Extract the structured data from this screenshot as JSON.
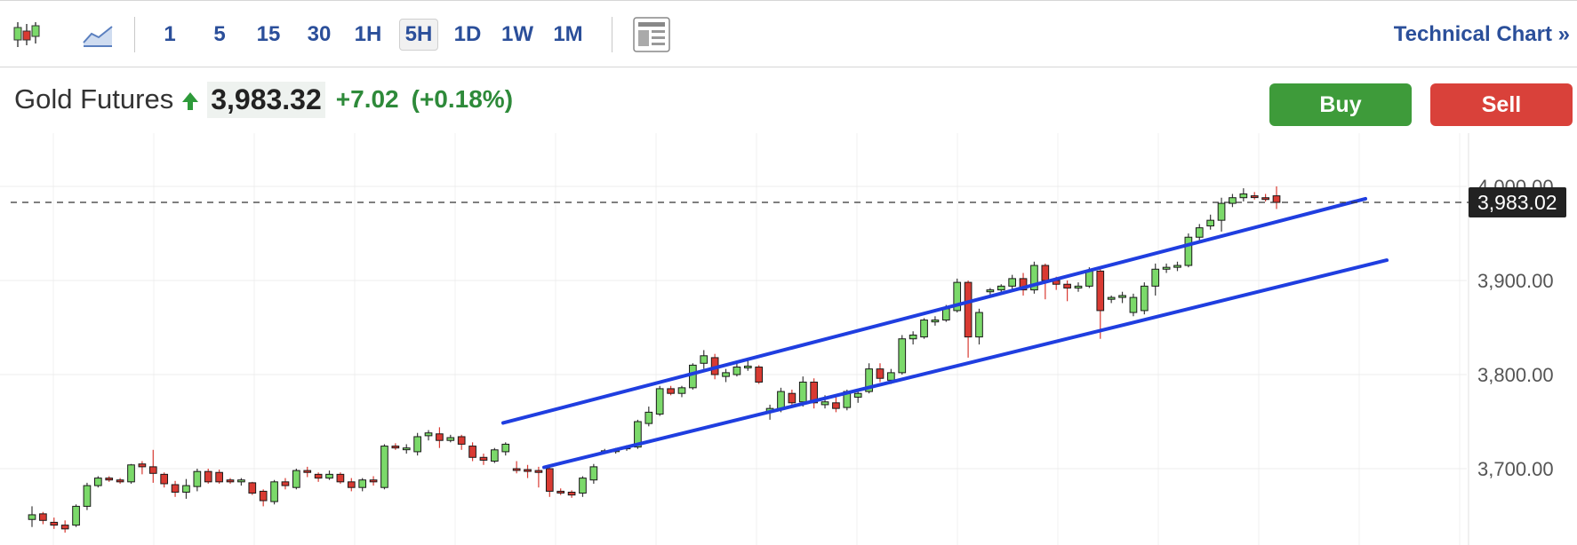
{
  "toolbar": {
    "chart_type_icons": [
      "candlestick-icon",
      "area-chart-icon"
    ],
    "intervals": [
      "1",
      "5",
      "15",
      "30",
      "1H",
      "5H",
      "1D",
      "1W",
      "1M"
    ],
    "active_interval": "5H",
    "layout_icon": "layout-icon",
    "technical_link": "Technical Chart »"
  },
  "quote": {
    "name": "Gold Futures",
    "direction_icon": "arrow-up-icon",
    "price": "3,983.32",
    "change": "+7.02",
    "change_pct": "(+0.18%)",
    "up_color": "#2e9a3a"
  },
  "actions": {
    "buy": "Buy",
    "sell": "Sell",
    "buy_color": "#3e9b3a",
    "sell_color": "#d9413a"
  },
  "chart_data": {
    "type": "candlestick",
    "y_ticks": [
      "4,000.00",
      "3,900.00",
      "3,800.00",
      "3,700.00"
    ],
    "y_tick_values": [
      4000,
      3900,
      3800,
      3700
    ],
    "ylim": [
      3640,
      4050
    ],
    "last_price_label": "3,983.02",
    "last_price": 3983.02,
    "candles": [
      [
        3646,
        3660,
        3638,
        3651
      ],
      [
        3652,
        3654,
        3641,
        3645
      ],
      [
        3643,
        3648,
        3636,
        3640
      ],
      [
        3640,
        3645,
        3632,
        3636
      ],
      [
        3640,
        3662,
        3638,
        3660
      ],
      [
        3660,
        3685,
        3656,
        3682
      ],
      [
        3682,
        3692,
        3680,
        3690
      ],
      [
        3690,
        3692,
        3686,
        3688
      ],
      [
        3688,
        3690,
        3684,
        3686
      ],
      [
        3686,
        3705,
        3684,
        3704
      ],
      [
        3705,
        3708,
        3694,
        3702
      ],
      [
        3702,
        3720,
        3685,
        3695
      ],
      [
        3694,
        3696,
        3680,
        3684
      ],
      [
        3683,
        3687,
        3670,
        3675
      ],
      [
        3675,
        3689,
        3668,
        3682
      ],
      [
        3681,
        3700,
        3676,
        3697
      ],
      [
        3697,
        3700,
        3684,
        3686
      ],
      [
        3696,
        3699,
        3684,
        3686
      ],
      [
        3688,
        3690,
        3684,
        3686
      ],
      [
        3686,
        3690,
        3682,
        3688
      ],
      [
        3685,
        3686,
        3672,
        3674
      ],
      [
        3676,
        3678,
        3660,
        3666
      ],
      [
        3665,
        3688,
        3662,
        3686
      ],
      [
        3686,
        3690,
        3678,
        3682
      ],
      [
        3680,
        3700,
        3678,
        3698
      ],
      [
        3698,
        3702,
        3691,
        3696
      ],
      [
        3694,
        3696,
        3686,
        3690
      ],
      [
        3690,
        3698,
        3688,
        3694
      ],
      [
        3694,
        3696,
        3684,
        3686
      ],
      [
        3686,
        3690,
        3676,
        3680
      ],
      [
        3680,
        3690,
        3676,
        3688
      ],
      [
        3688,
        3692,
        3682,
        3686
      ],
      [
        3680,
        3726,
        3678,
        3724
      ],
      [
        3724,
        3727,
        3720,
        3722
      ],
      [
        3722,
        3726,
        3716,
        3722
      ],
      [
        3718,
        3738,
        3714,
        3734
      ],
      [
        3735,
        3741,
        3730,
        3738
      ],
      [
        3737,
        3744,
        3722,
        3730
      ],
      [
        3730,
        3736,
        3728,
        3733
      ],
      [
        3734,
        3736,
        3720,
        3726
      ],
      [
        3724,
        3728,
        3708,
        3712
      ],
      [
        3712,
        3716,
        3704,
        3709
      ],
      [
        3708,
        3722,
        3706,
        3720
      ],
      [
        3718,
        3728,
        3714,
        3726
      ],
      [
        3700,
        3708,
        3695,
        3699
      ],
      [
        3699,
        3704,
        3690,
        3698
      ],
      [
        3698,
        3702,
        3680,
        3696
      ],
      [
        3700,
        3703,
        3670,
        3676
      ],
      [
        3676,
        3679,
        3672,
        3675
      ],
      [
        3675,
        3677,
        3669,
        3672
      ],
      [
        3674,
        3692,
        3670,
        3690
      ],
      [
        3688,
        3705,
        3684,
        3702
      ],
      [
        3718,
        3721,
        3716,
        3719
      ],
      [
        3719,
        3722,
        3716,
        3720
      ],
      [
        3722,
        3725,
        3719,
        3723
      ],
      [
        3723,
        3752,
        3721,
        3750
      ],
      [
        3748,
        3766,
        3745,
        3760
      ],
      [
        3758,
        3788,
        3756,
        3785
      ],
      [
        3785,
        3788,
        3778,
        3780
      ],
      [
        3780,
        3788,
        3776,
        3786
      ],
      [
        3786,
        3812,
        3784,
        3810
      ],
      [
        3812,
        3826,
        3806,
        3820
      ],
      [
        3818,
        3822,
        3795,
        3800
      ],
      [
        3798,
        3806,
        3792,
        3802
      ],
      [
        3800,
        3812,
        3798,
        3808
      ],
      [
        3808,
        3818,
        3804,
        3809
      ],
      [
        3808,
        3810,
        3790,
        3792
      ],
      [
        3760,
        3768,
        3752,
        3764
      ],
      [
        3764,
        3786,
        3760,
        3782
      ],
      [
        3780,
        3784,
        3766,
        3770
      ],
      [
        3771,
        3798,
        3766,
        3792
      ],
      [
        3792,
        3796,
        3764,
        3770
      ],
      [
        3768,
        3778,
        3764,
        3771
      ],
      [
        3770,
        3778,
        3760,
        3764
      ],
      [
        3765,
        3784,
        3762,
        3782
      ],
      [
        3776,
        3782,
        3770,
        3780
      ],
      [
        3782,
        3812,
        3780,
        3806
      ],
      [
        3806,
        3812,
        3792,
        3796
      ],
      [
        3794,
        3806,
        3790,
        3802
      ],
      [
        3802,
        3842,
        3800,
        3838
      ],
      [
        3838,
        3846,
        3832,
        3842
      ],
      [
        3840,
        3860,
        3838,
        3858
      ],
      [
        3856,
        3862,
        3852,
        3858
      ],
      [
        3858,
        3874,
        3856,
        3870
      ],
      [
        3868,
        3902,
        3866,
        3898
      ],
      [
        3898,
        3900,
        3818,
        3840
      ],
      [
        3840,
        3870,
        3832,
        3866
      ],
      [
        3888,
        3892,
        3882,
        3890
      ],
      [
        3890,
        3896,
        3886,
        3894
      ],
      [
        3894,
        3906,
        3890,
        3902
      ],
      [
        3902,
        3908,
        3884,
        3890
      ],
      [
        3890,
        3920,
        3886,
        3916
      ],
      [
        3916,
        3918,
        3880,
        3900
      ],
      [
        3900,
        3904,
        3890,
        3896
      ],
      [
        3896,
        3900,
        3878,
        3892
      ],
      [
        3892,
        3898,
        3888,
        3894
      ],
      [
        3894,
        3914,
        3892,
        3910
      ],
      [
        3910,
        3912,
        3838,
        3868
      ],
      [
        3880,
        3884,
        3876,
        3882
      ],
      [
        3882,
        3888,
        3876,
        3884
      ],
      [
        3866,
        3886,
        3862,
        3882
      ],
      [
        3868,
        3898,
        3864,
        3894
      ],
      [
        3894,
        3918,
        3884,
        3912
      ],
      [
        3912,
        3918,
        3908,
        3914
      ],
      [
        3914,
        3920,
        3910,
        3916
      ],
      [
        3916,
        3950,
        3914,
        3946
      ],
      [
        3946,
        3960,
        3942,
        3956
      ],
      [
        3958,
        3970,
        3954,
        3964
      ],
      [
        3964,
        3988,
        3952,
        3982
      ],
      [
        3982,
        3992,
        3978,
        3988
      ],
      [
        3988,
        3998,
        3984,
        3992
      ],
      [
        3990,
        3994,
        3986,
        3989
      ],
      [
        3988,
        3992,
        3984,
        3987
      ],
      [
        3990,
        4000,
        3976,
        3983
      ]
    ],
    "candle_span": [
      36,
      1436
    ],
    "channel_upper": [
      [
        566,
        3748.6
      ],
      [
        1536,
        3986.9
      ]
    ],
    "channel_lower": [
      [
        612,
        3701.4
      ],
      [
        1560,
        3921.6
      ]
    ],
    "up_color": "#7bd96a",
    "down_color": "#d93a32",
    "channel_color": "#1f3ee0"
  }
}
